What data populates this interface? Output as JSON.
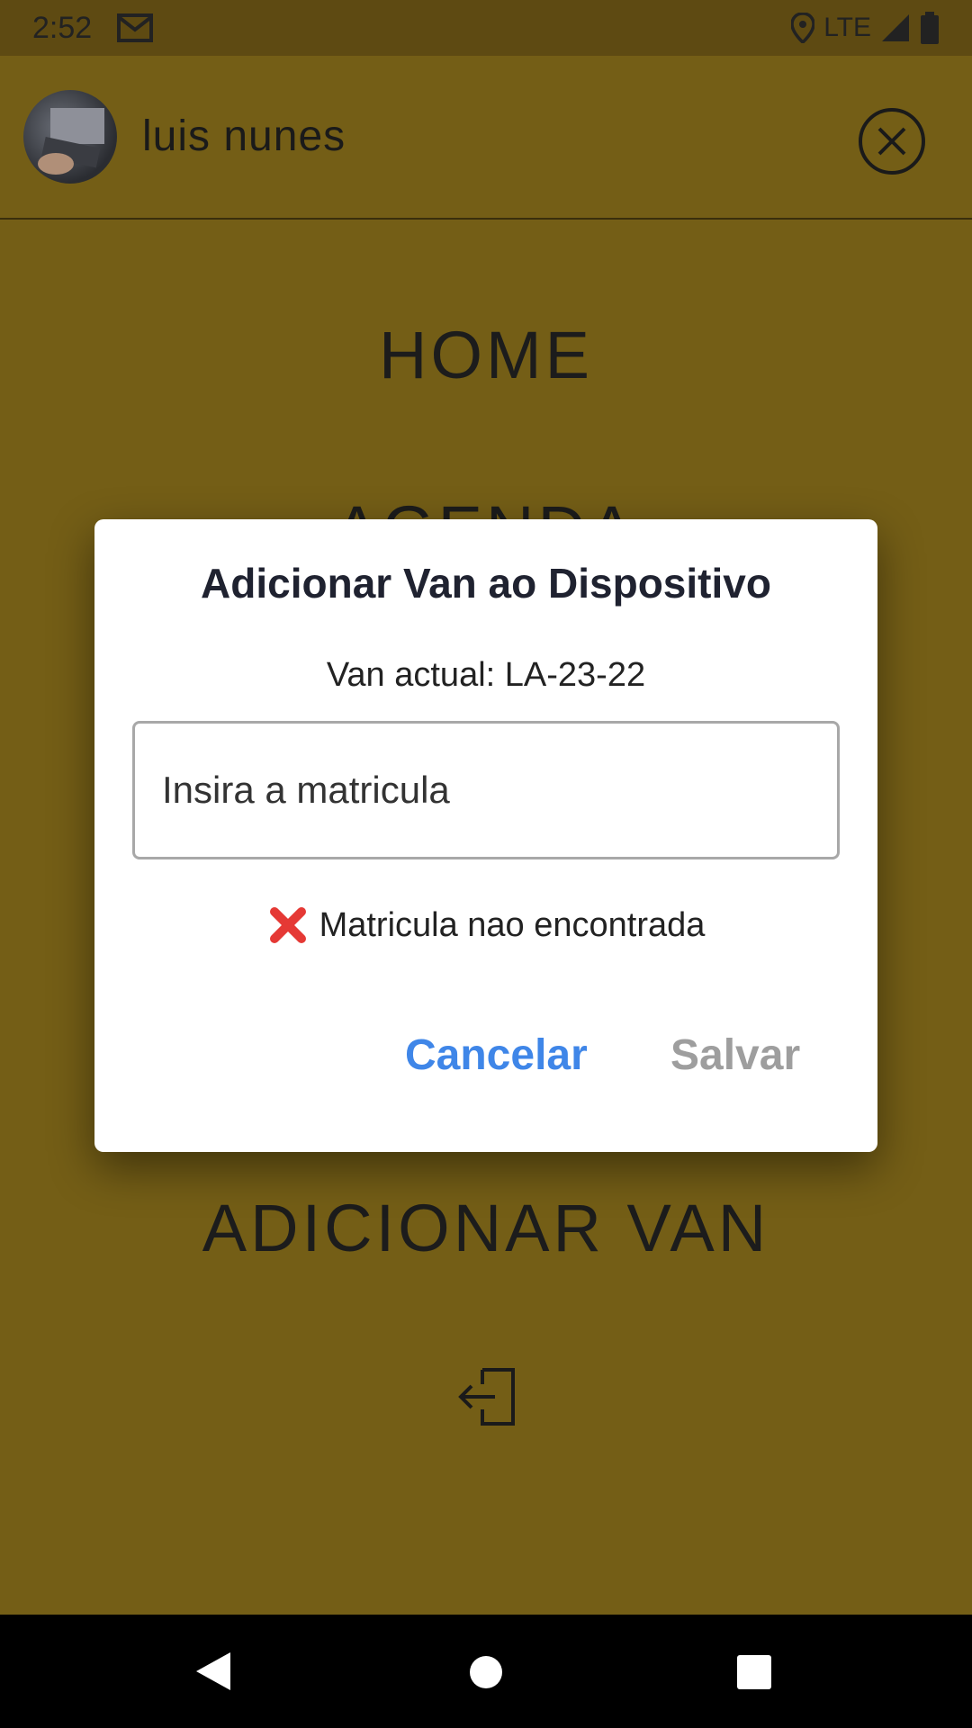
{
  "status_bar": {
    "time": "2:52",
    "network": "LTE"
  },
  "header": {
    "user_name": "luis nunes"
  },
  "menu": {
    "items": [
      "HOME",
      "AGENDA",
      "ADICIONAR VAN"
    ]
  },
  "dialog": {
    "title": "Adicionar Van ao Dispositivo",
    "current_van": "Van actual: LA-23-22",
    "input_value": "",
    "input_placeholder": "Insira a matricula",
    "error": "Matricula nao encontrada",
    "cancel_label": "Cancelar",
    "save_label": "Salvar"
  },
  "colors": {
    "background": "#745e16",
    "accent": "#3f86e8",
    "error": "#e53935",
    "disabled": "#9e9e9e"
  }
}
